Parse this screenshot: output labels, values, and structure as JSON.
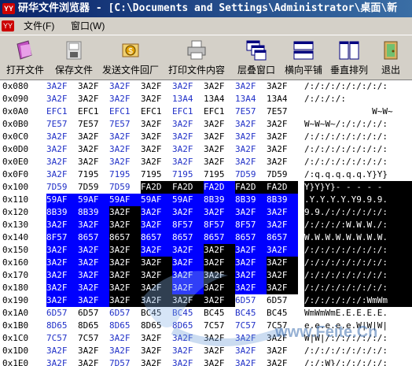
{
  "window": {
    "title": "研华文件浏览器 - [C:\\Documents and Settings\\Administrator\\桌面\\新",
    "icon_text": "YY"
  },
  "menu": {
    "logo": "YY",
    "items": [
      "文件(F)",
      "窗口(W)"
    ]
  },
  "toolbar": [
    {
      "label": "打开文件",
      "icon": "open-file-icon"
    },
    {
      "label": "保存文件",
      "icon": "save-file-icon"
    },
    {
      "label": "发送文件回厂",
      "icon": "send-file-icon"
    },
    {
      "label": "打印文件内容",
      "icon": "printer-icon"
    },
    {
      "label": "层叠窗口",
      "icon": "cascade-icon"
    },
    {
      "label": "横向平铺",
      "icon": "tile-horizontal-icon"
    },
    {
      "label": "垂直排列",
      "icon": "tile-vertical-icon"
    },
    {
      "label": "退出",
      "icon": "exit-icon"
    }
  ],
  "rows": [
    {
      "addr": "0x080",
      "cells": [
        "3A2F",
        "3A2F",
        "3A2F",
        "3A2F",
        "3A2F",
        "3A2F",
        "3A2F",
        "3A2F"
      ],
      "ascii": "/:/:/:/:/:/:/:/:"
    },
    {
      "addr": "0x090",
      "cells": [
        "3A2F",
        "3A2F",
        "3A2F",
        "3A2F",
        "13A4",
        "13A4",
        "13A4",
        "13A4"
      ],
      "ascii": "/:/:/:/:"
    },
    {
      "addr": "0x0A0",
      "cells": [
        "EFC1",
        "EFC1",
        "EFC1",
        "EFC1",
        "EFC1",
        "EFC1",
        "7E57",
        "7E57"
      ],
      "ascii": "             W~W~"
    },
    {
      "addr": "0x0B0",
      "cells": [
        "7E57",
        "7E57",
        "7E57",
        "3A2F",
        "3A2F",
        "3A2F",
        "3A2F",
        "3A2F"
      ],
      "ascii": "W~W~W~/:/:/:/:/:"
    },
    {
      "addr": "0x0C0",
      "cells": [
        "3A2F",
        "3A2F",
        "3A2F",
        "3A2F",
        "3A2F",
        "3A2F",
        "3A2F",
        "3A2F"
      ],
      "ascii": "/:/:/:/:/:/:/:/:"
    },
    {
      "addr": "0x0D0",
      "cells": [
        "3A2F",
        "3A2F",
        "3A2F",
        "3A2F",
        "3A2F",
        "3A2F",
        "3A2F",
        "3A2F"
      ],
      "ascii": "/:/:/:/:/:/:/:/:"
    },
    {
      "addr": "0x0E0",
      "cells": [
        "3A2F",
        "3A2F",
        "3A2F",
        "3A2F",
        "3A2F",
        "3A2F",
        "3A2F",
        "3A2F"
      ],
      "ascii": "/:/:/:/:/:/:/:/:"
    },
    {
      "addr": "0x0F0",
      "cells": [
        "3A2F",
        "7195",
        "7195",
        "7195",
        "7195",
        "7195",
        "7D59",
        "7D59"
      ],
      "ascii": "/:q.q.q.q.q.Y}Y}"
    },
    {
      "addr": "0x100",
      "cells": [
        "7D59",
        "7D59",
        "7D59",
        "FA2D",
        "FA2D",
        "FA2D",
        "FA2D",
        "FA2D"
      ],
      "ascii": "Y}Y}Y}- - - - -"
    },
    {
      "addr": "0x110",
      "cells": [
        "59AF",
        "59AF",
        "59AF",
        "59AF",
        "59AF",
        "8B39",
        "8B39",
        "8B39"
      ],
      "ascii": ".Y.Y.Y.Y.Y9.9.9."
    },
    {
      "addr": "0x120",
      "cells": [
        "8B39",
        "8B39",
        "3A2F",
        "3A2F",
        "3A2F",
        "3A2F",
        "3A2F",
        "3A2F"
      ],
      "ascii": "9.9./:/:/:/:/:/:"
    },
    {
      "addr": "0x130",
      "cells": [
        "3A2F",
        "3A2F",
        "3A2F",
        "3A2F",
        "8F57",
        "8F57",
        "8F57",
        "3A2F"
      ],
      "ascii": "/:/:/:/:W.W.W./:"
    },
    {
      "addr": "0x140",
      "cells": [
        "8F57",
        "8657",
        "8657",
        "8657",
        "8657",
        "8657",
        "8657",
        "8657"
      ],
      "ascii": "W.W.W.W.W.W.W.W."
    },
    {
      "addr": "0x150",
      "cells": [
        "3A2F",
        "3A2F",
        "3A2F",
        "3A2F",
        "3A2F",
        "3A2F",
        "3A2F",
        "3A2F"
      ],
      "ascii": "/:/:/:/:/:/:/:/:"
    },
    {
      "addr": "0x160",
      "cells": [
        "3A2F",
        "3A2F",
        "3A2F",
        "3A2F",
        "3A2F",
        "3A2F",
        "3A2F",
        "3A2F"
      ],
      "ascii": "/:/:/:/:/:/:/:/:"
    },
    {
      "addr": "0x170",
      "cells": [
        "3A2F",
        "3A2F",
        "3A2F",
        "3A2F",
        "3A2F",
        "3A2F",
        "3A2F",
        "3A2F"
      ],
      "ascii": "/:/:/:/:/:/:/:/:"
    },
    {
      "addr": "0x180",
      "cells": [
        "3A2F",
        "3A2F",
        "3A2F",
        "3A2F",
        "3A2F",
        "3A2F",
        "3A2F",
        "3A2F"
      ],
      "ascii": "/:/:/:/:/:/:/:/:"
    },
    {
      "addr": "0x190",
      "cells": [
        "3A2F",
        "3A2F",
        "3A2F",
        "3A2F",
        "3A2F",
        "3A2F",
        "6D57",
        "6D57"
      ],
      "ascii": "/:/:/:/:/:/:WmWm"
    },
    {
      "addr": "0x1A0",
      "cells": [
        "6D57",
        "6D57",
        "6D57",
        "BC45",
        "BC45",
        "BC45",
        "BC45",
        "BC45"
      ],
      "ascii": "WmWmWmE.E.E.E.E."
    },
    {
      "addr": "0x1B0",
      "cells": [
        "8D65",
        "8D65",
        "8D65",
        "8D65",
        "8D65",
        "7C57",
        "7C57",
        "7C57"
      ],
      "ascii": "e.e.e.e.e.W|W|W|"
    },
    {
      "addr": "0x1C0",
      "cells": [
        "7C57",
        "7C57",
        "3A2F",
        "3A2F",
        "3A2F",
        "3A2F",
        "3A2F",
        "3A2F"
      ],
      "ascii": "W|W|/:/:/:/:/:/:"
    },
    {
      "addr": "0x1D0",
      "cells": [
        "3A2F",
        "3A2F",
        "3A2F",
        "3A2F",
        "3A2F",
        "3A2F",
        "3A2F",
        "3A2F"
      ],
      "ascii": "/:/:/:/:/:/:/:/:"
    },
    {
      "addr": "0x1E0",
      "cells": [
        "3A2F",
        "3A2F",
        "7D57",
        "3A2F",
        "3A2F",
        "3A2F",
        "3A2F",
        "3A2F"
      ],
      "ascii": "/:/:W}/:/:/:/:/:"
    },
    {
      "addr": "0x1F0",
      "cells": [
        "3A2F",
        "3A2F",
        "3A2F",
        "3A2F",
        "3A2F",
        "3A2F",
        "3A2F",
        "3A2F"
      ],
      "ascii": "/:/:/:/:/:/:/:/:"
    }
  ],
  "watermark": {
    "text": "www.Feite.Cn"
  },
  "colors": {
    "hex_text": "#2030c8",
    "sel_blue": "#0000ff",
    "sel_black": "#000000"
  }
}
